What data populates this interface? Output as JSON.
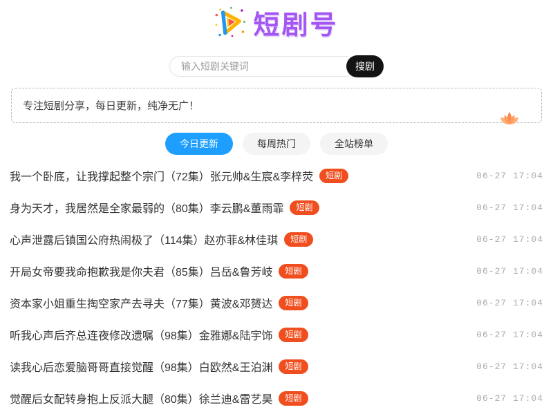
{
  "site": {
    "title": "短剧号"
  },
  "search": {
    "placeholder": "输入短剧关键词",
    "button": "搜剧"
  },
  "notice": {
    "text": "专注短剧分享，每日更新，纯净无广！"
  },
  "tabs": [
    {
      "label": "今日更新",
      "active": true
    },
    {
      "label": "每周热门",
      "active": false
    },
    {
      "label": "全站榜单",
      "active": false
    }
  ],
  "list": {
    "badge": "短剧",
    "items": [
      {
        "title": "我一个卧底，让我撑起整个宗门（72集）张元帅&生宸&李梓荧",
        "date": "06-27 17:04"
      },
      {
        "title": "身为天才，我居然是全家最弱的（80集）李云鹏&董雨霏",
        "date": "06-27 17:04"
      },
      {
        "title": "心声泄露后镇国公府热闹极了（114集）赵亦菲&林佳琪",
        "date": "06-27 17:04"
      },
      {
        "title": "开局女帝要我命抱歉我是你夫君（85集）吕岳&鲁芳岐",
        "date": "06-27 17:04"
      },
      {
        "title": "资本家小姐重生掏空家产去寻夫（77集）黄波&邓赟达",
        "date": "06-27 17:04"
      },
      {
        "title": "听我心声后齐总连夜修改遗嘱（98集）金雅娜&陆宇饰",
        "date": "06-27 17:04"
      },
      {
        "title": "读我心后恋爱脑哥哥直接觉醒（98集）白欧然&王泊渊",
        "date": "06-27 17:04"
      },
      {
        "title": "觉醒后女配转身抱上反派大腿（80集）徐兰迪&雷艺昊",
        "date": "06-27 17:04"
      }
    ]
  },
  "colors": {
    "accent_blue": "#1e9fff",
    "badge_orange": "#f04e1e",
    "logo_purple": "#a356f2",
    "button_black": "#141414",
    "leaf_orange": "#ff8a4d"
  }
}
